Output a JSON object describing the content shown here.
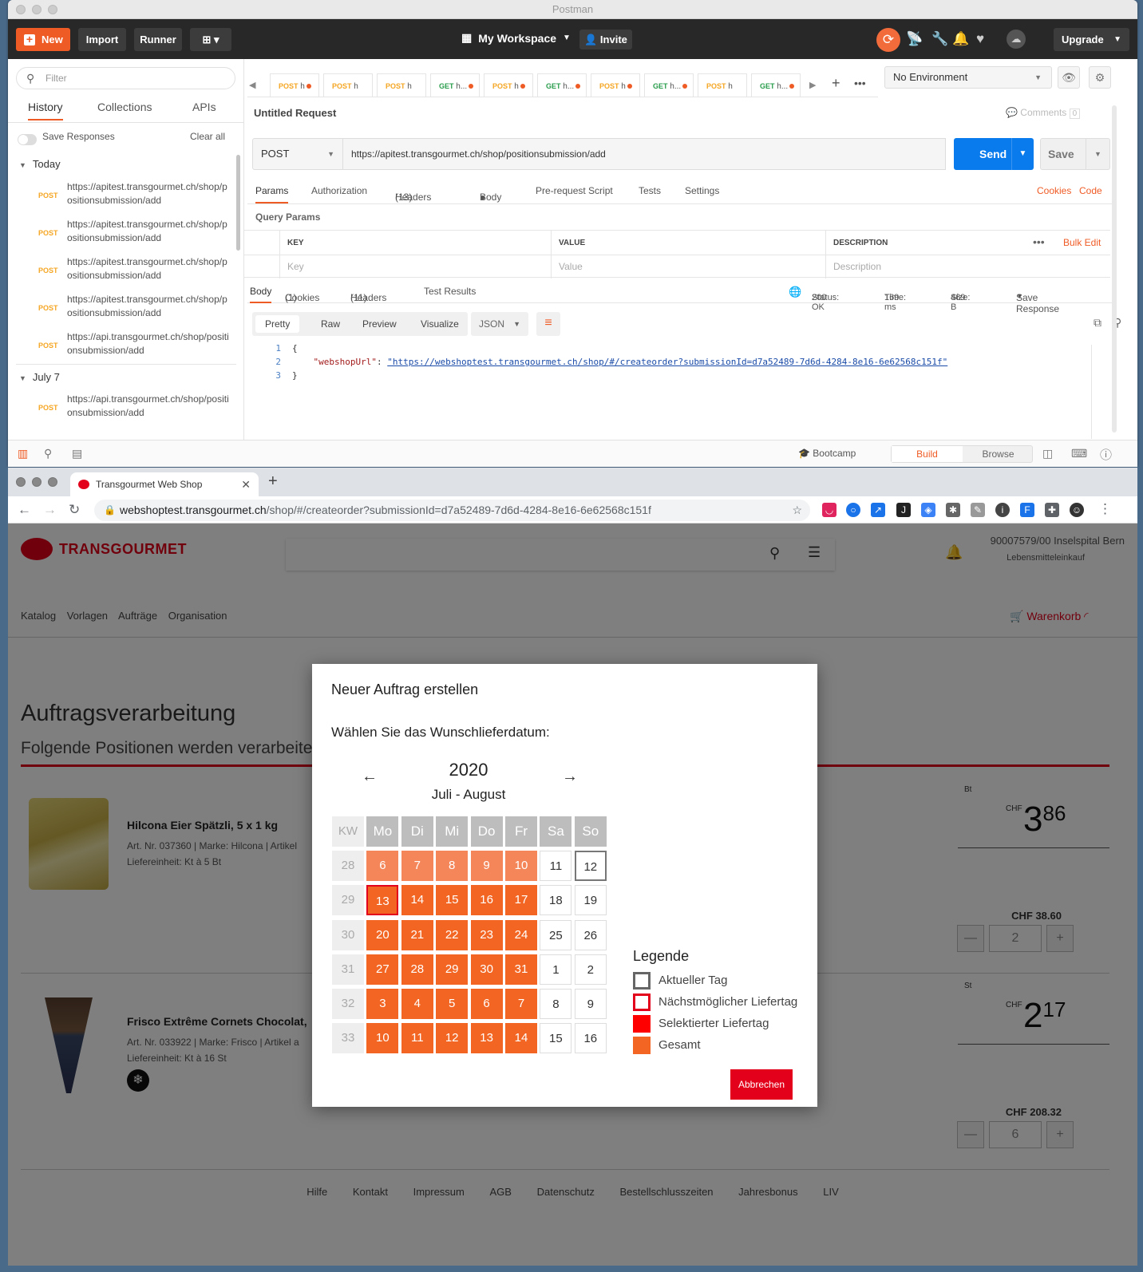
{
  "postman": {
    "window_title": "Postman",
    "toolbar": {
      "new_label": "New",
      "import_label": "Import",
      "runner_label": "Runner",
      "workspace_label": "My Workspace",
      "invite_label": "Invite",
      "upgrade_label": "Upgrade"
    },
    "sidebar": {
      "filter_placeholder": "Filter",
      "tabs": [
        "History",
        "Collections",
        "APIs"
      ],
      "save_responses_label": "Save Responses",
      "clear_all_label": "Clear all",
      "groups": [
        {
          "label": "Today",
          "items": [
            {
              "method": "POST",
              "url": "https://apitest.transgourmet.ch/shop/positionsubmission/add"
            },
            {
              "method": "POST",
              "url": "https://apitest.transgourmet.ch/shop/positionsubmission/add"
            },
            {
              "method": "POST",
              "url": "https://apitest.transgourmet.ch/shop/positionsubmission/add"
            },
            {
              "method": "POST",
              "url": "https://apitest.transgourmet.ch/shop/positionsubmission/add"
            },
            {
              "method": "POST",
              "url": "https://api.transgourmet.ch/shop/positionsubmission/add"
            }
          ]
        },
        {
          "label": "July 7",
          "items": [
            {
              "method": "POST",
              "url": "https://api.transgourmet.ch/shop/positionsubmission/add"
            }
          ]
        }
      ]
    },
    "request_tabs": [
      {
        "method": "POST",
        "label": "h",
        "dot": true
      },
      {
        "method": "POST",
        "label": "h",
        "dot": false
      },
      {
        "method": "POST",
        "label": "h",
        "dot": false
      },
      {
        "method": "GET",
        "label": "h...",
        "dot": true
      },
      {
        "method": "POST",
        "label": "h",
        "dot": true
      },
      {
        "method": "GET",
        "label": "h...",
        "dot": true
      },
      {
        "method": "POST",
        "label": "h",
        "dot": true
      },
      {
        "method": "GET",
        "label": "h...",
        "dot": true
      },
      {
        "method": "POST",
        "label": "h",
        "dot": false
      },
      {
        "method": "GET",
        "label": "h...",
        "dot": true
      }
    ],
    "environment": "No Environment",
    "request": {
      "title": "Untitled Request",
      "comments_label": "Comments",
      "comments_count": "0",
      "method": "POST",
      "url": "https://apitest.transgourmet.ch/shop/positionsubmission/add",
      "send_label": "Send",
      "save_label": "Save"
    },
    "param_tabs": {
      "params": "Params",
      "authorization": "Authorization",
      "headers": "Headers",
      "headers_count": "(13)",
      "body": "Body",
      "prerequest": "Pre-request Script",
      "tests": "Tests",
      "settings": "Settings",
      "cookies": "Cookies",
      "code": "Code"
    },
    "query_params": {
      "title": "Query Params",
      "col_key": "KEY",
      "col_value": "VALUE",
      "col_description": "DESCRIPTION",
      "bulk_edit": "Bulk Edit",
      "key_placeholder": "Key",
      "value_placeholder": "Value",
      "description_placeholder": "Description"
    },
    "response": {
      "body_tab": "Body",
      "cookies_tab": "Cookies",
      "cookies_count": "(1)",
      "headers_tab": "Headers",
      "headers_count": "(11)",
      "tests_tab": "Test Results",
      "status_label": "Status:",
      "status_value": "200 OK",
      "time_label": "Time:",
      "time_value": "169 ms",
      "size_label": "Size:",
      "size_value": "469 B",
      "save_response": "Save Response",
      "views": [
        "Pretty",
        "Raw",
        "Preview",
        "Visualize"
      ],
      "format": "JSON",
      "code_lines": [
        {
          "n": "1",
          "text": "{"
        },
        {
          "n": "2",
          "key": "\"webshopUrl\"",
          "value": "\"https://webshoptest.transgourmet.ch/shop/#/createorder?submissionId=d7a52489-7d6d-4284-8e16-6e62568c151f\""
        },
        {
          "n": "3",
          "text": "}"
        }
      ]
    },
    "footer": {
      "bootcamp": "Bootcamp",
      "build": "Build",
      "browse": "Browse"
    }
  },
  "browser": {
    "tab_title": "Transgourmet Web Shop",
    "url_host": "webshoptest.transgourmet.ch",
    "url_path": "/shop/#/createorder?submissionId=d7a52489-7d6d-4284-8e16-6e62568c151f"
  },
  "shop": {
    "logo_text": "TRANSGOURMET",
    "account_line1": "90007579/00 Inselspital Bern",
    "account_line2": "Lebensmitteleinkauf",
    "nav": [
      "Katalog",
      "Vorlagen",
      "Aufträge",
      "Organisation"
    ],
    "cart_label": "Warenkorb",
    "page_title": "Auftragsverarbeitung",
    "page_subtitle": "Folgende Positionen werden verarbeitet",
    "products": [
      {
        "name": "Hilcona Eier Spätzli, 5 x 1 kg",
        "meta1": "Art. Nr. 037360 | Marke: Hilcona | Artikel",
        "meta2": "Liefereinheit: Kt à 5 Bt",
        "unit": "Bt",
        "currency": "CHF",
        "price_int": "3",
        "price_dec": "86",
        "total": "CHF 38.60",
        "qty": "2"
      },
      {
        "name": "Frisco Extrême Cornets Chocolat,",
        "meta1": "Art. Nr. 033922 | Marke: Frisco | Artikel a",
        "meta2": "Liefereinheit: Kt à 16 St",
        "unit": "St",
        "currency": "CHF",
        "price_int": "2",
        "price_dec": "17",
        "total": "CHF 208.32",
        "qty": "6"
      }
    ],
    "footer_links": [
      "Hilfe",
      "Kontakt",
      "Impressum",
      "AGB",
      "Datenschutz",
      "Bestellschlusszeiten",
      "Jahresbonus",
      "LIV"
    ]
  },
  "modal": {
    "title": "Neuer Auftrag erstellen",
    "subtitle": "Wählen Sie das Wunschlieferdatum:",
    "year": "2020",
    "months": "Juli - August",
    "header": [
      "KW",
      "Mo",
      "Di",
      "Mi",
      "Do",
      "Fr",
      "Sa",
      "So"
    ],
    "weeks": [
      {
        "kw": "28",
        "days": [
          "6",
          "7",
          "8",
          "9",
          "10",
          "11",
          "12"
        ],
        "states": [
          "av-l",
          "av-l",
          "av-l",
          "av-l",
          "av-l",
          "plain",
          "today"
        ]
      },
      {
        "kw": "29",
        "days": [
          "13",
          "14",
          "15",
          "16",
          "17",
          "18",
          "19"
        ],
        "states": [
          "av next",
          "av",
          "av",
          "av",
          "av",
          "plain",
          "plain"
        ]
      },
      {
        "kw": "30",
        "days": [
          "20",
          "21",
          "22",
          "23",
          "24",
          "25",
          "26"
        ],
        "states": [
          "av",
          "av",
          "av",
          "av",
          "av",
          "plain",
          "plain"
        ]
      },
      {
        "kw": "31",
        "days": [
          "27",
          "28",
          "29",
          "30",
          "31",
          "1",
          "2"
        ],
        "states": [
          "av",
          "av",
          "av",
          "av",
          "av",
          "plain",
          "plain"
        ]
      },
      {
        "kw": "32",
        "days": [
          "3",
          "4",
          "5",
          "6",
          "7",
          "8",
          "9"
        ],
        "states": [
          "av",
          "av",
          "av",
          "av",
          "av",
          "plain",
          "plain"
        ]
      },
      {
        "kw": "33",
        "days": [
          "10",
          "11",
          "12",
          "13",
          "14",
          "15",
          "16"
        ],
        "states": [
          "av",
          "av",
          "av",
          "av",
          "av",
          "plain",
          "plain"
        ]
      }
    ],
    "legend_title": "Legende",
    "legend": [
      {
        "label": "Aktueller Tag",
        "style": "today"
      },
      {
        "label": "Nächstmöglicher Liefertag",
        "style": "next"
      },
      {
        "label": "Selektierter Liefertag",
        "style": "selected"
      },
      {
        "label": "Gesamt",
        "style": "all"
      }
    ],
    "cancel_label": "Abbrechen"
  },
  "colors": {
    "postman_orange": "#ef5b25",
    "send_blue": "#097bed",
    "transgourmet_red": "#e3001b",
    "available_day": "#f26522"
  }
}
